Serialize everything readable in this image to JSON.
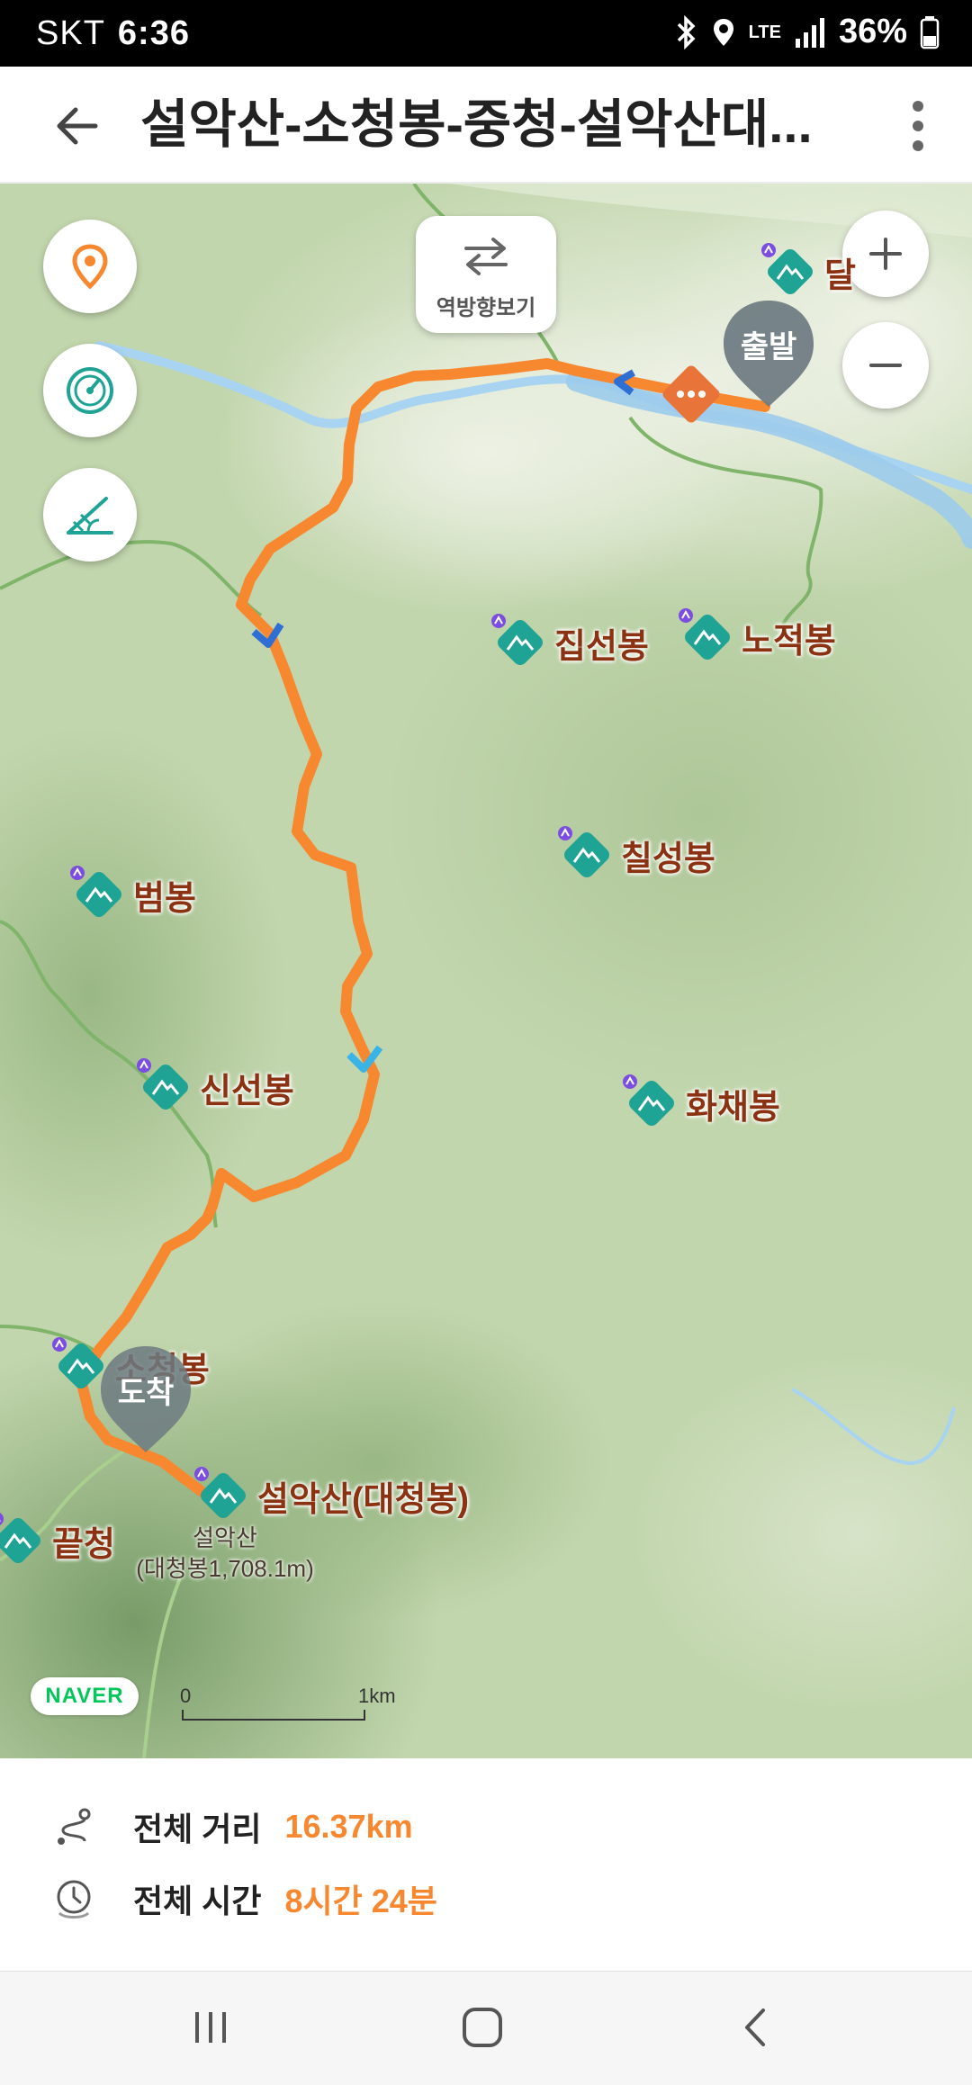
{
  "status_bar": {
    "carrier": "SKT",
    "time": "6:36",
    "network": "LTE",
    "battery": "36%",
    "icons": [
      "bluetooth-icon",
      "location-icon",
      "lte-icon",
      "signal-icon",
      "battery-icon"
    ]
  },
  "header": {
    "title": "설악산-소청봉-중청-설악산대...",
    "back_icon": "arrow-left-icon",
    "more_icon": "more-vertical-icon"
  },
  "map": {
    "reverse_direction_label": "역방향보기",
    "start_label": "출발",
    "end_label": "도착",
    "peaks": [
      {
        "name": "달"
      },
      {
        "name": "집선봉"
      },
      {
        "name": "노적봉"
      },
      {
        "name": "칠성봉"
      },
      {
        "name": "범봉"
      },
      {
        "name": "신선봉"
      },
      {
        "name": "화채봉"
      },
      {
        "name": "소청봉"
      },
      {
        "name": "설악산(대청봉)"
      },
      {
        "name": "끝청"
      }
    ],
    "summit_detail_line1": "설악산",
    "summit_detail_line2": "(대청봉1,708.1m)",
    "logo_text": "NAVER",
    "scale_start": "0",
    "scale_end": "1km",
    "colors": {
      "route": "#f7882f",
      "peak_icon": "#1fa394",
      "peak_label": "#8a3212",
      "marker": "#6c7a80"
    }
  },
  "summary": {
    "distance_label": "전체 거리",
    "distance_value": "16.37km",
    "time_label": "전체 시간",
    "time_value": "8시간 24분"
  },
  "nav_bar": {
    "icons": [
      "recent-apps-icon",
      "home-icon",
      "back-icon"
    ]
  }
}
